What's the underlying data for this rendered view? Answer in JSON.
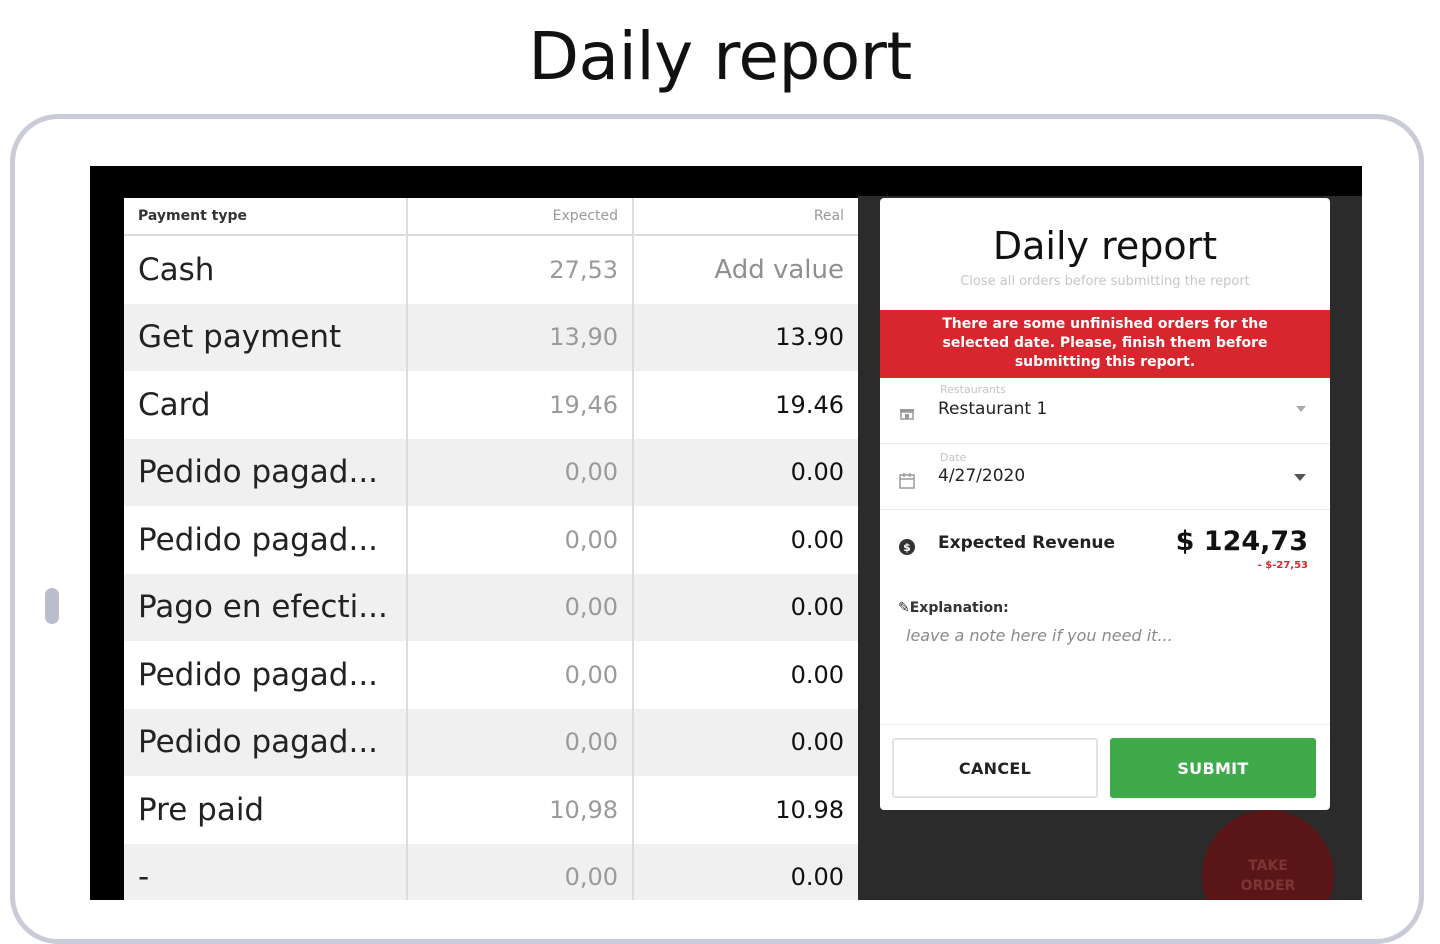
{
  "page_title": "Daily report",
  "table": {
    "headers": {
      "type": "Payment type",
      "expected": "Expected",
      "real": "Real"
    },
    "rows": [
      {
        "type": "Cash",
        "expected": "27,53",
        "real": "Add value",
        "real_is_placeholder": true
      },
      {
        "type": "Get payment",
        "expected": "13,90",
        "real": "13.90"
      },
      {
        "type": "Card",
        "expected": "19,46",
        "real": "19.46"
      },
      {
        "type": "Pedido pagad...",
        "expected": "0,00",
        "real": "0.00"
      },
      {
        "type": "Pedido pagad...",
        "expected": "0,00",
        "real": "0.00"
      },
      {
        "type": "Pago en efecti...",
        "expected": "0,00",
        "real": "0.00"
      },
      {
        "type": "Pedido pagad...",
        "expected": "0,00",
        "real": "0.00"
      },
      {
        "type": "Pedido pagad...",
        "expected": "0,00",
        "real": "0.00"
      },
      {
        "type": "Pre paid",
        "expected": "10,98",
        "real": "10.98"
      },
      {
        "type": "-",
        "expected": "0,00",
        "real": "0.00"
      }
    ]
  },
  "modal": {
    "title": "Daily report",
    "subtitle": "Close all orders before submitting the report",
    "alert": "There are some unfinished orders for the selected date. Please, finish them before submitting this report.",
    "restaurant": {
      "caption": "Restaurants",
      "value": "Restaurant 1",
      "icon": "store-icon"
    },
    "date": {
      "caption": "Date",
      "value": "4/27/2020",
      "icon": "calendar-icon"
    },
    "revenue": {
      "label": "Expected Revenue",
      "value": "$ 124,73",
      "diff": "- $-27,53",
      "icon": "dollar-icon"
    },
    "explanation": {
      "label": "Explanation:",
      "placeholder": "leave a note here if you need it..."
    },
    "cancel_label": "CANCEL",
    "submit_label": "SUBMIT"
  },
  "take_order": {
    "line1": "TAKE",
    "line2": "ORDER"
  },
  "colors": {
    "alert": "#d8262e",
    "submit": "#3eaa4a",
    "frame": "#c9ccd8",
    "take_order": "#5a1616"
  }
}
